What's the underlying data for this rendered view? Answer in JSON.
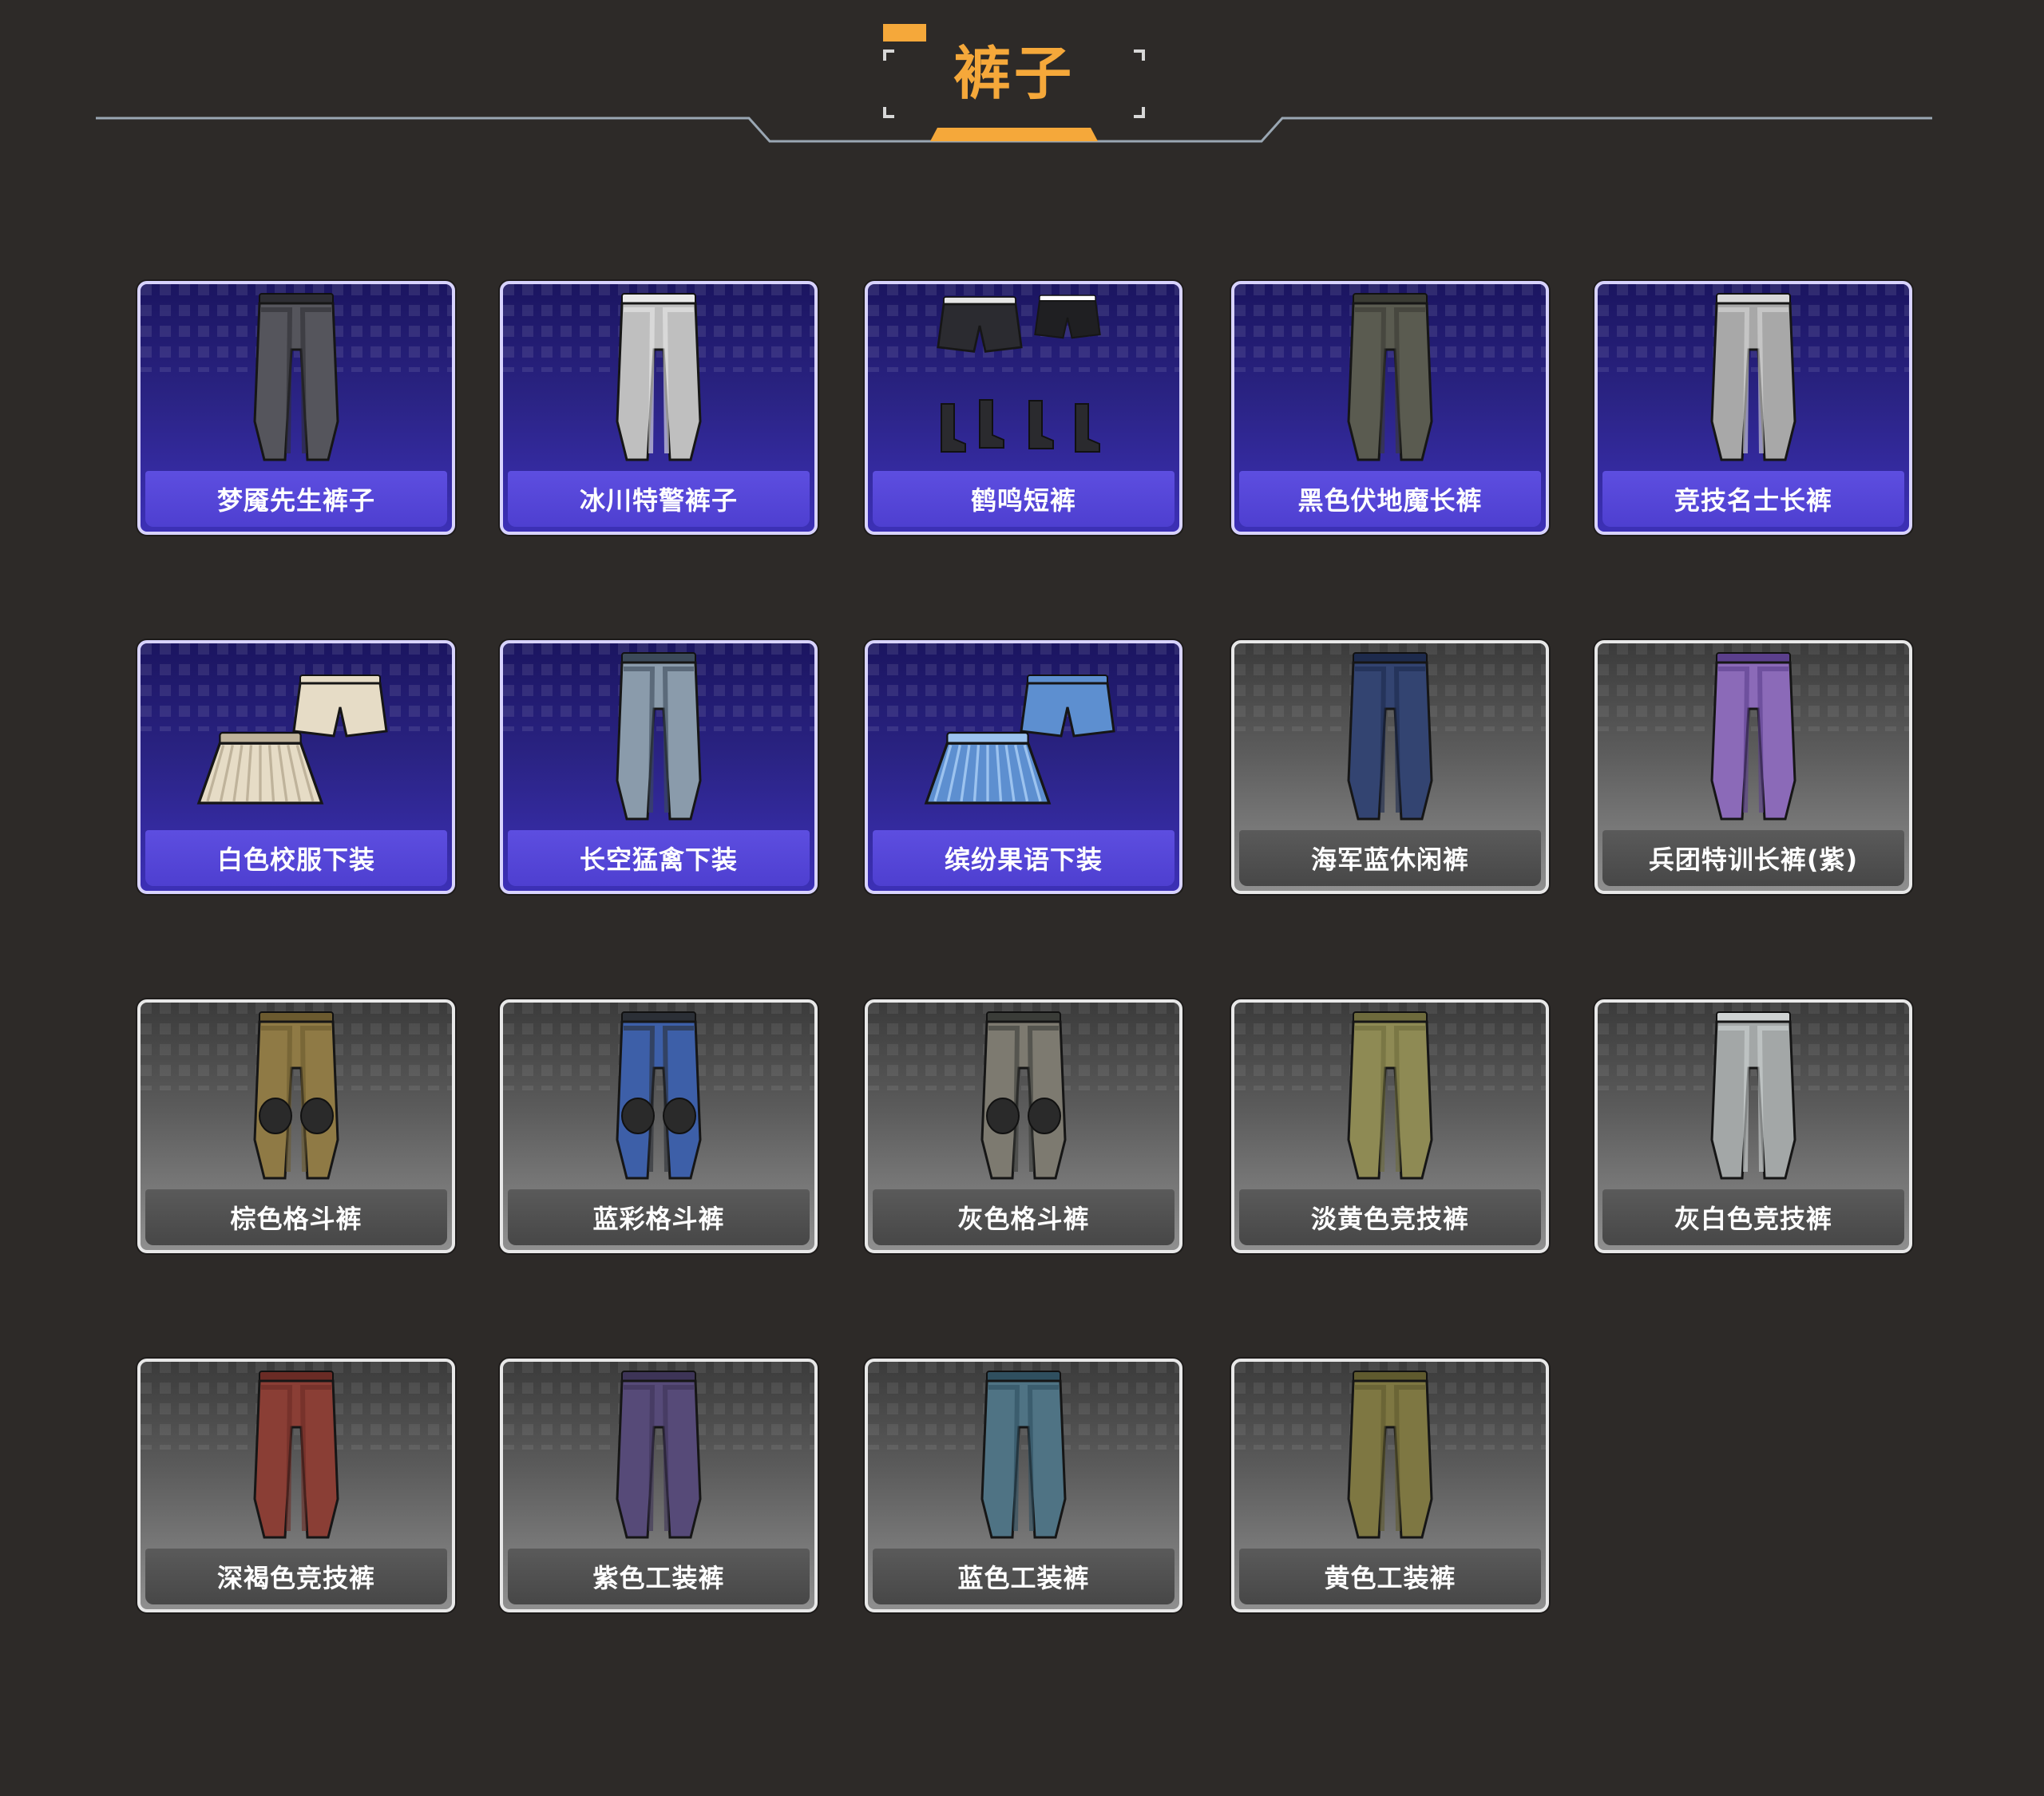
{
  "section": {
    "title": "裤子",
    "accent_color": "#f5a83a",
    "line_color": "#9aa7b3"
  },
  "items": [
    {
      "name": "梦魇先生裤子",
      "rarity": "purple",
      "art": "black-leather-pants",
      "colors": [
        "#2e2e33",
        "#55555c"
      ]
    },
    {
      "name": "冰川特警裤子",
      "rarity": "purple",
      "art": "white-tactical-pants",
      "colors": [
        "#e9e9e9",
        "#bfbfbf"
      ]
    },
    {
      "name": "鹤鸣短裤",
      "rarity": "purple",
      "art": "shorts-and-boots-set",
      "colors": [
        "#2b2b30",
        "#7a7a85"
      ]
    },
    {
      "name": "黑色伏地魔长裤",
      "rarity": "purple",
      "art": "dark-olive-pants",
      "colors": [
        "#3a3b33",
        "#5a5b50"
      ]
    },
    {
      "name": "竞技名士长裤",
      "rarity": "purple",
      "art": "light-gray-pants",
      "colors": [
        "#d8d8d8",
        "#a8a8a8"
      ]
    },
    {
      "name": "白色校服下装",
      "rarity": "purple",
      "art": "pleated-skirt-and-shorts",
      "colors": [
        "#e6dcc6",
        "#bfb39b"
      ]
    },
    {
      "name": "长空猛禽下装",
      "rarity": "purple",
      "art": "camo-pants",
      "colors": [
        "#3c4a5a",
        "#8a9bab"
      ]
    },
    {
      "name": "缤纷果语下装",
      "rarity": "purple",
      "art": "blue-skirt-and-shorts",
      "colors": [
        "#5d8fd0",
        "#9cc3ef"
      ]
    },
    {
      "name": "海军蓝休闲裤",
      "rarity": "gray",
      "art": "navy-pants",
      "colors": [
        "#1d2a4c",
        "#334471"
      ]
    },
    {
      "name": "兵团特训长裤(紫)",
      "rarity": "gray",
      "art": "purple-camo-pants",
      "colors": [
        "#5b3f8c",
        "#8b6ab8"
      ]
    },
    {
      "name": "棕色格斗裤",
      "rarity": "gray",
      "art": "brown-combat-pants",
      "colors": [
        "#6b5a2f",
        "#8f7a45"
      ]
    },
    {
      "name": "蓝彩格斗裤",
      "rarity": "gray",
      "art": "blue-combat-pants",
      "colors": [
        "#2b2f36",
        "#3d5fa8"
      ]
    },
    {
      "name": "灰色格斗裤",
      "rarity": "gray",
      "art": "gray-combat-pants",
      "colors": [
        "#3a3c38",
        "#7d7a70"
      ]
    },
    {
      "name": "淡黄色竞技裤",
      "rarity": "gray",
      "art": "khaki-pants",
      "colors": [
        "#6d6a3c",
        "#8e8a54"
      ]
    },
    {
      "name": "灰白色竞技裤",
      "rarity": "gray",
      "art": "off-white-pants",
      "colors": [
        "#cfd3d3",
        "#a3a7a7"
      ]
    },
    {
      "name": "深褐色竞技裤",
      "rarity": "gray",
      "art": "maroon-pants",
      "colors": [
        "#6a2b25",
        "#8a3e35"
      ]
    },
    {
      "name": "紫色工装裤",
      "rarity": "gray",
      "art": "purple-cargo-pants",
      "colors": [
        "#3d3457",
        "#564a78"
      ]
    },
    {
      "name": "蓝色工装裤",
      "rarity": "gray",
      "art": "teal-cargo-pants",
      "colors": [
        "#2f4f5f",
        "#4f7384"
      ]
    },
    {
      "name": "黄色工装裤",
      "rarity": "gray",
      "art": "olive-cargo-pants",
      "colors": [
        "#5f5a2e",
        "#7e7742"
      ]
    }
  ]
}
